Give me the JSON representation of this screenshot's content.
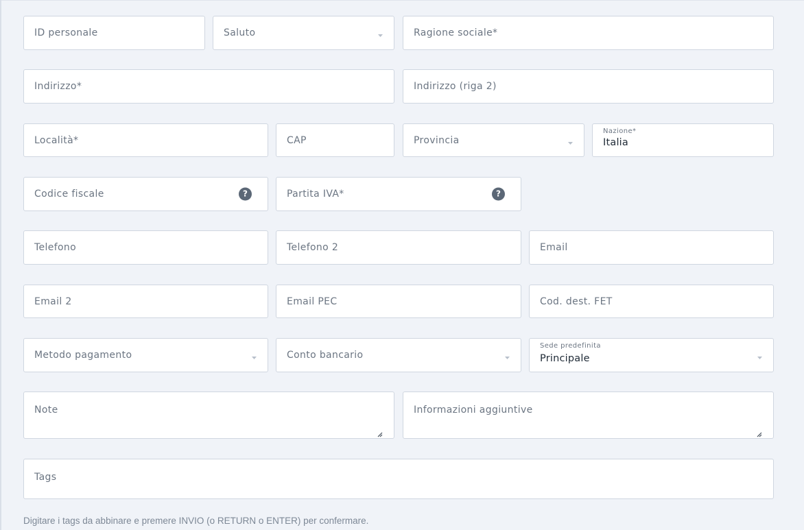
{
  "form": {
    "id_personale": {
      "label": "ID personale"
    },
    "saluto": {
      "label": "Saluto"
    },
    "ragione_sociale": {
      "label": "Ragione sociale*"
    },
    "indirizzo": {
      "label": "Indirizzo*"
    },
    "indirizzo2": {
      "label": "Indirizzo (riga 2)"
    },
    "localita": {
      "label": "Località*"
    },
    "cap": {
      "label": "CAP"
    },
    "provincia": {
      "label": "Provincia"
    },
    "nazione": {
      "label": "Nazione*",
      "value": "Italia"
    },
    "codice_fiscale": {
      "label": "Codice fiscale",
      "help_icon": "question-circle-icon"
    },
    "partita_iva": {
      "label": "Partita IVA*",
      "help_icon": "question-circle-icon"
    },
    "telefono": {
      "label": "Telefono"
    },
    "telefono2": {
      "label": "Telefono 2"
    },
    "email": {
      "label": "Email"
    },
    "email2": {
      "label": "Email 2"
    },
    "email_pec": {
      "label": "Email PEC"
    },
    "cod_dest_fet": {
      "label": "Cod. dest. FET"
    },
    "metodo_pagamento": {
      "label": "Metodo pagamento"
    },
    "conto_bancario": {
      "label": "Conto bancario"
    },
    "sede_predefinita": {
      "label": "Sede predefinita",
      "value": "Principale"
    },
    "note": {
      "label": "Note"
    },
    "informazioni": {
      "label": "Informazioni aggiuntive"
    },
    "tags": {
      "label": "Tags"
    },
    "tags_hint": "Digitare i tags da abbinare e premere INVIO (o RETURN o ENTER) per confermare."
  },
  "colors": {
    "background": "#f0f3f8",
    "field_border": "#cfd6e0",
    "label_text": "#6b7582",
    "value_text": "#1f2a36",
    "help_icon_bg": "#5b6776"
  }
}
